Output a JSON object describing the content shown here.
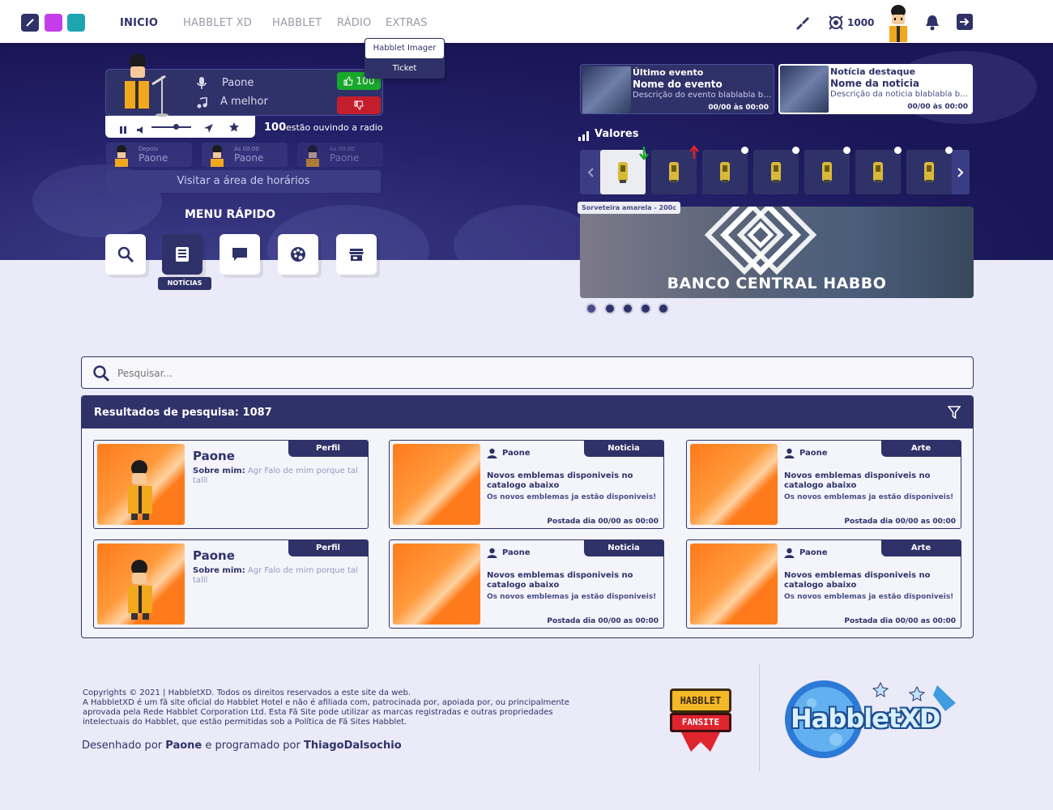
{
  "topbar": {
    "nav": [
      "INICIO",
      "HABBLET XD",
      "HABBLET",
      "RÁDIO",
      "EXTRAS"
    ],
    "extras_menu": [
      "Habblet Imager",
      "Ticket"
    ],
    "coins": "1000",
    "theme_colors": [
      "#2f3268",
      "#c43de8",
      "#1fa5b1"
    ]
  },
  "player": {
    "host": "Paone",
    "song": "A melhor",
    "likes": "100",
    "listeners_count": "100",
    "listeners_label": "estão ouvindo a radio"
  },
  "schedule": [
    {
      "time": "Depois",
      "name": "Paone"
    },
    {
      "time": "Às 00:00",
      "name": "Paone"
    },
    {
      "time": "Às 00:00",
      "name": "Paone"
    }
  ],
  "visit_schedule": "Visitar a área de horários",
  "quick_menu": {
    "title": "MENU RÁPIDO",
    "tooltip": "NOTÍCIAS",
    "icons": [
      "search-icon",
      "news-icon",
      "chat-icon",
      "palette-icon",
      "store-icon"
    ]
  },
  "events": [
    {
      "label": "Último evento",
      "title": "Nome do evento",
      "desc": "Descrição do evento blablabla blablabla",
      "date": "00/00 às 00:00"
    },
    {
      "label": "Notícia destaque",
      "title": "Nome da noticia",
      "desc": "Descrição da noticia blablabla blablabla",
      "date": "00/00 às 00:00"
    }
  ],
  "values": {
    "title": "Valores",
    "tooltip": "Sorveteira amarela - 200c"
  },
  "banner": {
    "title": "BANCO CENTRAL HABBO"
  },
  "search": {
    "placeholder": "Pesquisar..."
  },
  "results": {
    "header": "Resultados de pesquisa: 1087",
    "profile": {
      "tag": "Perfil",
      "name": "Paone",
      "about_label": "Sobre mim:",
      "about": "Agr Falo de mim porque tal talll"
    },
    "news": {
      "tag": "Noticia",
      "author": "Paone",
      "title": "Novos emblemas disponiveis no catalogo abaixo",
      "subtitle": "Os novos emblemas ja estão disponiveis!",
      "date": "Postada dia 00/00 as 00:00"
    },
    "art": {
      "tag": "Arte",
      "author": "Paone",
      "title": "Novos emblemas disponiveis no catalogo abaixo",
      "subtitle": "Os novos emblemas ja estão disponiveis!",
      "date": "Postada dia 00/00 as 00:00"
    }
  },
  "footer": {
    "copyright": "Copyrights © 2021 | HabbletXD. Todos os direitos reservados a este site da web.",
    "legal": "A HabbletXD é um fã site oficial do Habblet Hotel e não é afiliada com, patrocinada por, apoiada por, ou principalmente aprovada pela Rede Habblet Corporation Ltd. Esta Fã Site pode utilizar as marcas registradas e outras propriedades intelectuais do Habblet, que estão permitidas sob a Política de Fã Sites Habblet.",
    "credit_prefix": "Desenhado por",
    "designer": "Paone",
    "credit_mid": "e programado por",
    "developer": "ThiagoDalsochio",
    "badge_line1": "HABBLET",
    "badge_line2": "FANSITE",
    "logo": "HabbletXD"
  }
}
